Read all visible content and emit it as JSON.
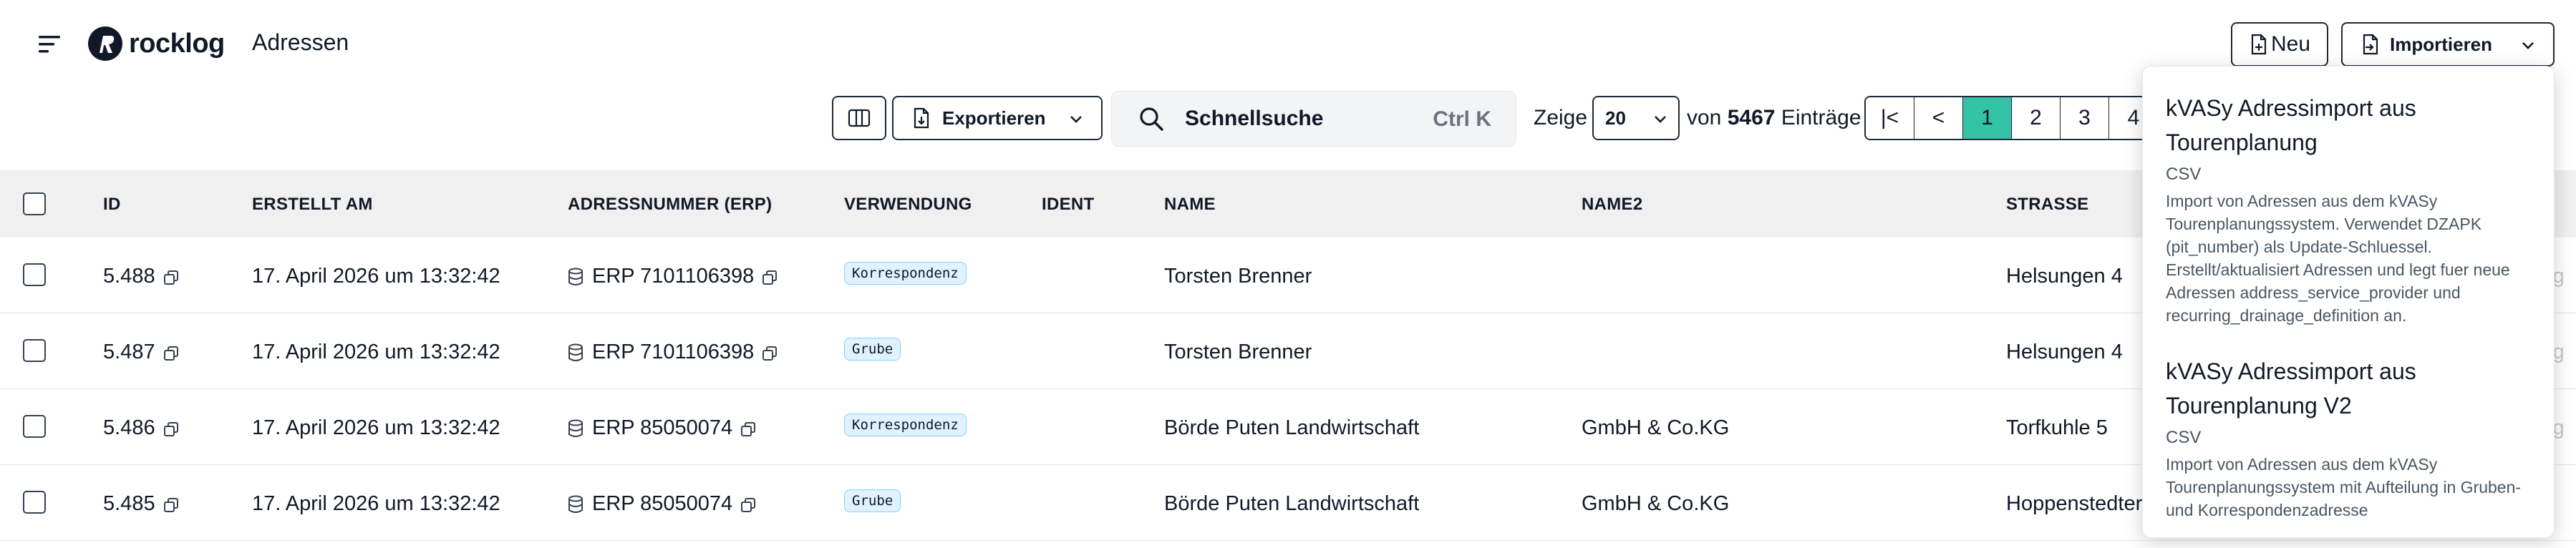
{
  "app": {
    "brand": "rocklog",
    "page_title": "Adressen"
  },
  "header": {
    "new_label": "Neu",
    "import_label": "Importieren"
  },
  "toolbar": {
    "export_label": "Exportieren",
    "search_label": "Schnellsuche",
    "search_shortcut": "Ctrl K",
    "show_label": "Zeige",
    "page_size": "20",
    "count_prefix": "von",
    "count_total": "5467",
    "count_suffix": "Einträge"
  },
  "pagination": {
    "first": "|<",
    "prev": "<",
    "pages": [
      "1",
      "2",
      "3",
      "4"
    ],
    "active_page": "1"
  },
  "table": {
    "columns": [
      "ID",
      "ERSTELLT AM",
      "ADRESSNUMMER (ERP)",
      "VERWENDUNG",
      "IDENT",
      "NAME",
      "NAME2",
      "STRASSE"
    ],
    "rows": [
      {
        "id": "5.488",
        "created": "17. April 2026 um 13:32:42",
        "erp": "ERP 7101106398",
        "usage": "Korrespondenz",
        "ident": "",
        "name": "Torsten Brenner",
        "name2": "",
        "street": "Helsungen 4",
        "overflow": "rg"
      },
      {
        "id": "5.487",
        "created": "17. April 2026 um 13:32:42",
        "erp": "ERP 7101106398",
        "usage": "Grube",
        "ident": "",
        "name": "Torsten Brenner",
        "name2": "",
        "street": "Helsungen 4",
        "overflow": "rg"
      },
      {
        "id": "5.486",
        "created": "17. April 2026 um 13:32:42",
        "erp": "ERP 85050074",
        "usage": "Korrespondenz",
        "ident": "",
        "name": "Börde Puten Landwirtschaft",
        "name2": "GmbH & Co.KG",
        "street": "Torfkuhle 5",
        "overflow": "rg"
      },
      {
        "id": "5.485",
        "created": "17. April 2026 um 13:32:42",
        "erp": "ERP 85050074",
        "usage": "Grube",
        "ident": "",
        "name": "Börde Puten Landwirtschaft",
        "name2": "GmbH & Co.KG",
        "street": "Hoppenstedter",
        "overflow": ""
      }
    ]
  },
  "import_menu": [
    {
      "title": "kVASy Adressimport aus Tourenplanung",
      "type": "CSV",
      "description": "Import von Adressen aus dem kVASy Tourenplanungssystem. Verwendet DZAPK (pit_number) als Update-Schluessel. Erstellt/aktualisiert Adressen und legt fuer neue Adressen address_service_provider und recurring_drainage_definition an."
    },
    {
      "title": "kVASy Adressimport aus Tourenplanung V2",
      "type": "CSV",
      "description": "Import von Adressen aus dem kVASy Tourenplanungssystem mit Aufteilung in Gruben- und Korrespondenzadresse"
    }
  ],
  "colors": {
    "accent": "#34c3a7",
    "header_bg": "#f0f0f0",
    "badge_bg": "#e0f2fe",
    "badge_border": "#7dd3fc"
  }
}
